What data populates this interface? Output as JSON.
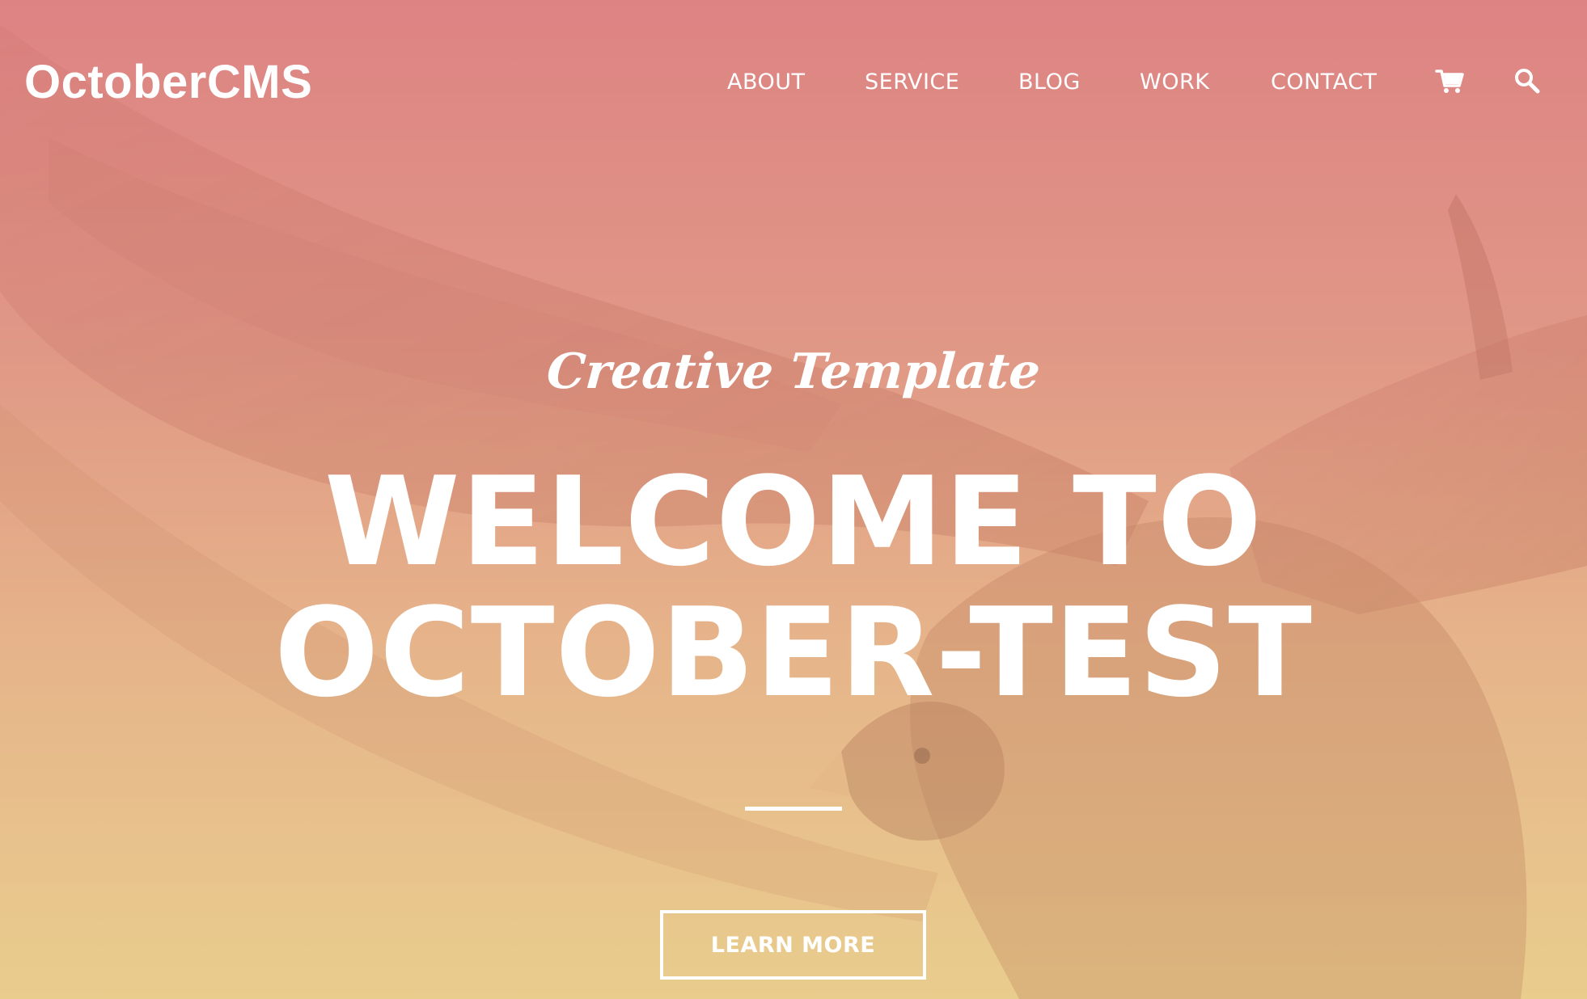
{
  "brand": {
    "name": "OctoberCMS"
  },
  "nav": {
    "items": [
      {
        "label": "ABOUT"
      },
      {
        "label": "SERVICE"
      },
      {
        "label": "BLOG"
      },
      {
        "label": "WORK"
      },
      {
        "label": "CONTACT"
      }
    ],
    "icons": [
      "shopping-cart-icon",
      "search-icon"
    ]
  },
  "hero": {
    "subtitle": "Creative Template",
    "headline_line1": "WELCOME TO",
    "headline_line2": "OCTOBER-TEST",
    "cta_label": "LEARN MORE"
  },
  "colors": {
    "gradient_top": "#de8384",
    "gradient_bottom": "#e9cd8d",
    "text": "#ffffff"
  }
}
